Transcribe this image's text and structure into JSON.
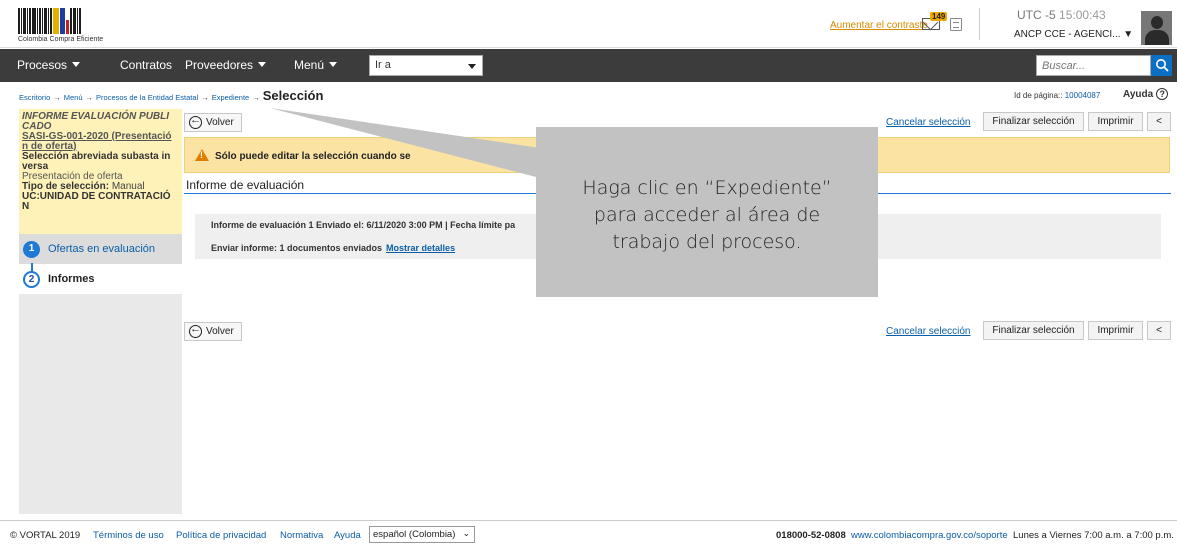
{
  "header": {
    "logo_text": "Colombia Compra Eficiente",
    "contrast_link": "Aumentar el contraste",
    "mail_badge": "149",
    "tz_label": "UTC -5",
    "time": "15:00:43",
    "entity": "ANCP CCE - AGENCI... ▼"
  },
  "nav": {
    "items": [
      "Procesos",
      "Contratos",
      "Proveedores",
      "Menú"
    ],
    "goto_value": "Ir a",
    "search_placeholder": "Buscar..."
  },
  "breadcrumb": {
    "items": [
      "Escritorio",
      "Menú",
      "Procesos de la Entidad Estatal",
      "Expediente"
    ],
    "current": "Selección",
    "page_id_label": "Id de página::",
    "page_id": "10004087",
    "help": "Ayuda"
  },
  "sidebar": {
    "info_title": "INFORME EVALUACIÓN PUBLI CADO",
    "info_ref": "SASI-GS-001-2020 (Presentació n de oferta)",
    "info_type": "Selección abreviada subasta in versa",
    "info_phase": "Presentación de oferta",
    "info_sel_label": "Tipo de selección:",
    "info_sel_value": "Manual",
    "info_uc": "UC:UNIDAD DE CONTRATACIÓ N",
    "steps": [
      {
        "num": "1",
        "label": "Ofertas en evaluación"
      },
      {
        "num": "2",
        "label": "Informes"
      }
    ]
  },
  "toolbar": {
    "back": "Volver",
    "cancel": "Cancelar selección",
    "finalize": "Finalizar selección",
    "print": "Imprimir",
    "collapse": "<"
  },
  "warning": {
    "text": "Sólo puede editar la selección cuando se"
  },
  "section": {
    "title": "Informe de evaluación",
    "row1": "Informe de evaluación 1  Enviado el: 6/11/2020 3:00 PM | Fecha límite pa",
    "row2_label": "Enviar informe: 1 documentos enviados",
    "row2_link": "Mostrar detalles"
  },
  "callout": {
    "line1": "Haga clic en “Expediente”",
    "line2": "para acceder al área de",
    "line3": "trabajo del proceso."
  },
  "footer": {
    "copyright": "© VORTAL 2019",
    "terms": "Términos de uso",
    "privacy": "Política de privacidad",
    "normativa": "Normativa",
    "help": "Ayuda",
    "language": "español (Colombia)",
    "phone": "018000-52-0808",
    "support_url": "www.colombiacompra.gov.co/soporte",
    "hours": "Lunes a Viernes 7:00 a.m. a 7:00 p.m."
  },
  "colors": {
    "nav_bg": "#3c3c3c",
    "accent": "#1f7ad6",
    "warning_bg": "#fbe3a4",
    "callout_bg": "#c2c2c2",
    "info_bg": "#fff2b8"
  }
}
